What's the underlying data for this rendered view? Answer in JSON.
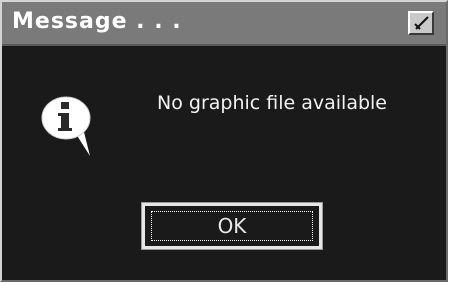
{
  "window": {
    "title": "Message . . .",
    "close_icon": "close-icon"
  },
  "content": {
    "icon": "info-icon",
    "message": "No graphic file available"
  },
  "buttons": {
    "ok_label": "OK"
  }
}
